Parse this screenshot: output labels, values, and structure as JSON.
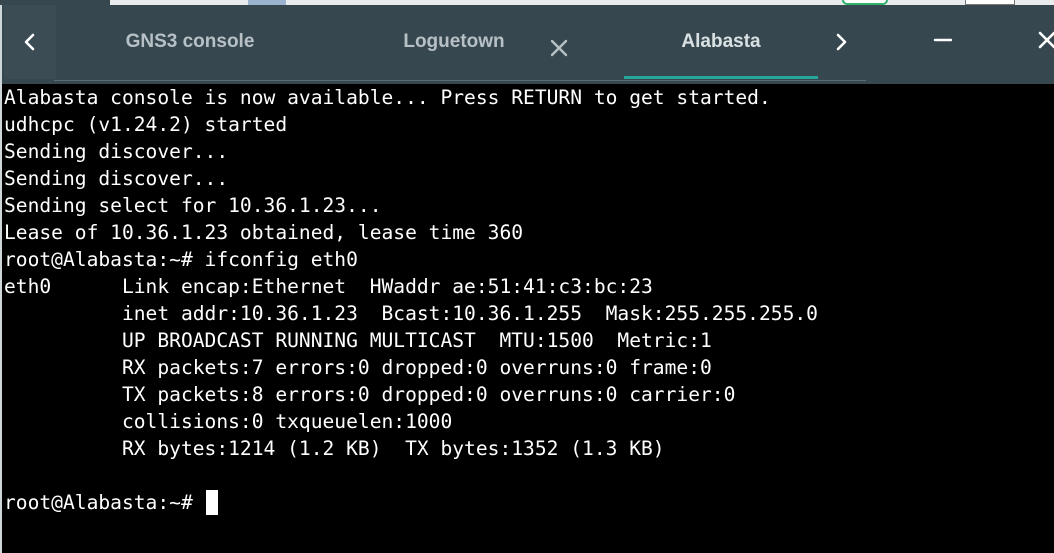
{
  "window": {
    "minimize_icon": "minus-icon",
    "close_icon": "close-icon"
  },
  "tabbar": {
    "prev_icon": "chevron-left-icon",
    "next_icon": "chevron-right-icon",
    "tab_close_icon": "close-icon",
    "tabs": [
      {
        "label": "GNS3 console",
        "active": false
      },
      {
        "label": "Loguetown",
        "active": false
      },
      {
        "label": "Alabasta",
        "active": true
      }
    ],
    "accent_color": "#26a69a",
    "bar_color": "#37474f"
  },
  "terminal": {
    "background": "#000000",
    "foreground": "#ffffff",
    "lines": [
      "Alabasta console is now available... Press RETURN to get started.",
      "udhcpc (v1.24.2) started",
      "Sending discover...",
      "Sending discover...",
      "Sending select for 10.36.1.23...",
      "Lease of 10.36.1.23 obtained, lease time 360",
      "root@Alabasta:~# ifconfig eth0",
      "eth0      Link encap:Ethernet  HWaddr ae:51:41:c3:bc:23",
      "          inet addr:10.36.1.23  Bcast:10.36.1.255  Mask:255.255.255.0",
      "          UP BROADCAST RUNNING MULTICAST  MTU:1500  Metric:1",
      "          RX packets:7 errors:0 dropped:0 overruns:0 frame:0",
      "          TX packets:8 errors:0 dropped:0 overruns:0 carrier:0",
      "          collisions:0 txqueuelen:1000",
      "          RX bytes:1214 (1.2 KB)  TX bytes:1352 (1.3 KB)",
      ""
    ],
    "prompt": "root@Alabasta:~# "
  }
}
